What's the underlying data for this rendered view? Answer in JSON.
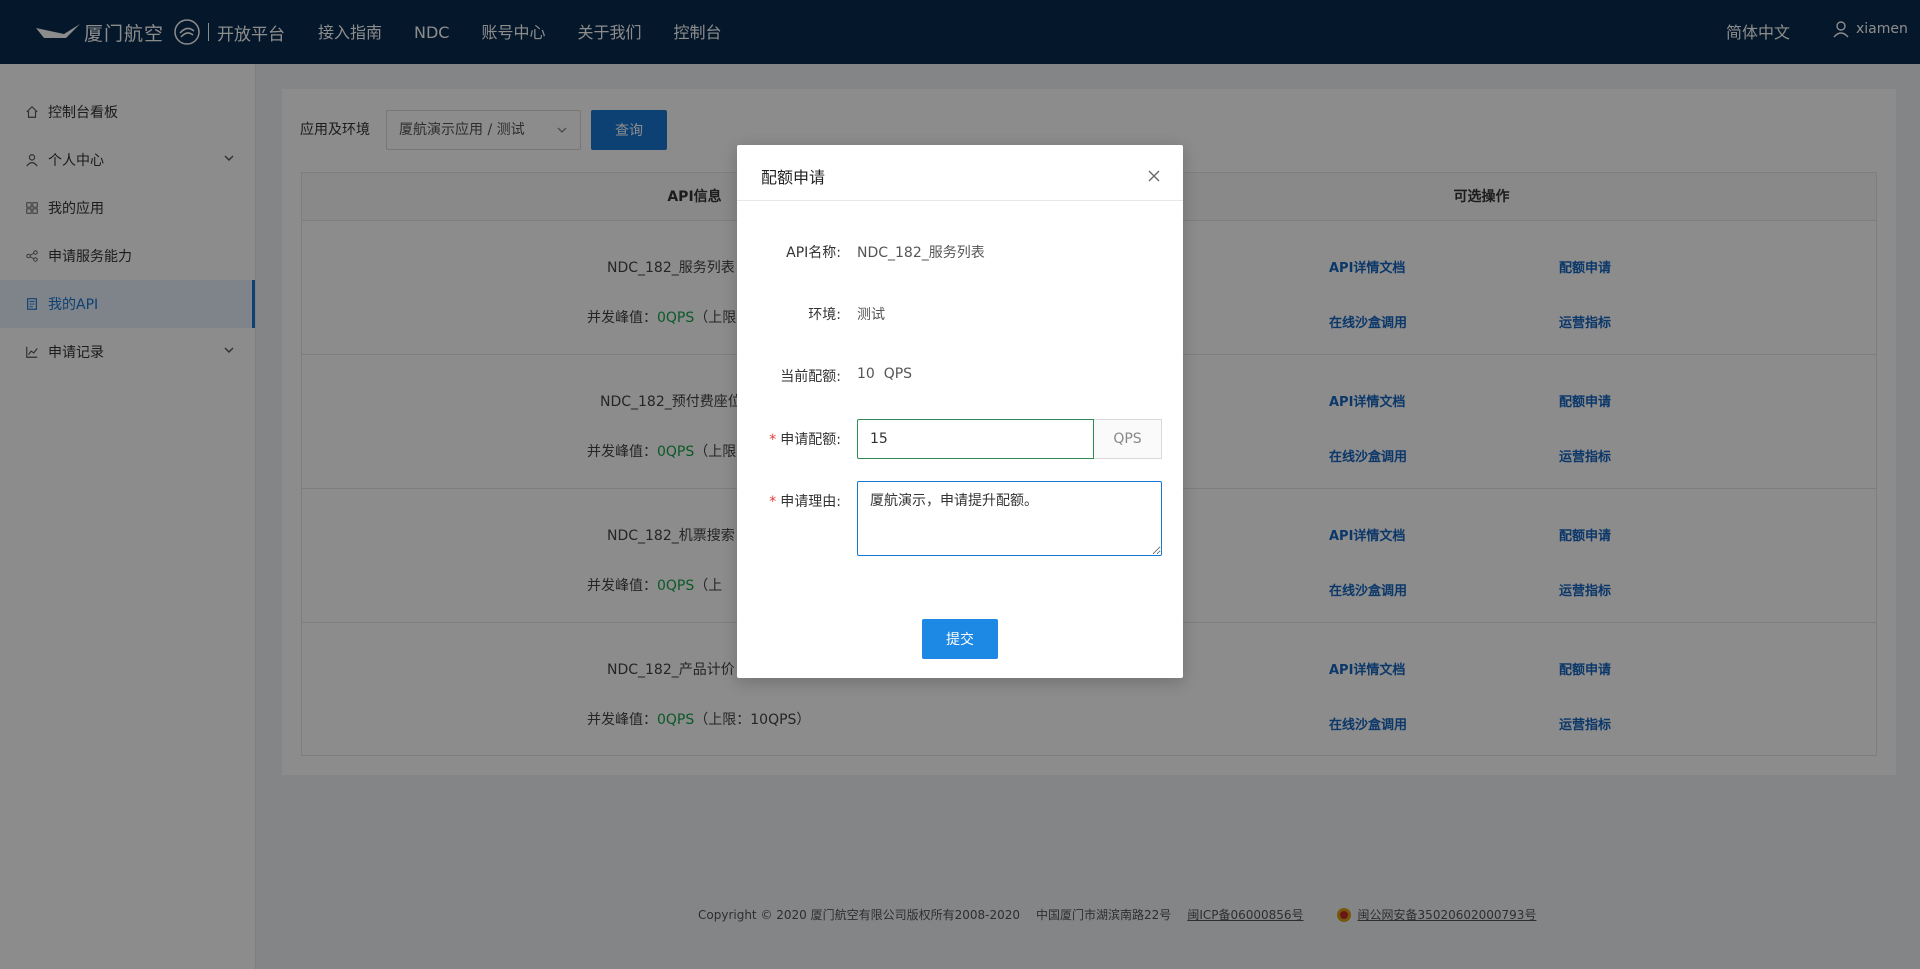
{
  "header": {
    "logo_text": "厦门航空",
    "logo_sub": "开放平台",
    "nav": [
      "接入指南",
      "NDC",
      "账号中心",
      "关于我们",
      "控制台"
    ],
    "language": "简体中文",
    "username": "xiamen"
  },
  "sidebar": {
    "items": [
      {
        "label": "控制台看板",
        "icon": "home-icon"
      },
      {
        "label": "个人中心",
        "icon": "user-icon",
        "expandable": true
      },
      {
        "label": "我的应用",
        "icon": "grid-icon"
      },
      {
        "label": "申请服务能力",
        "icon": "share-icon"
      },
      {
        "label": "我的API",
        "icon": "document-icon",
        "active": true
      },
      {
        "label": "申请记录",
        "icon": "chart-icon",
        "expandable": true
      }
    ]
  },
  "filter": {
    "label": "应用及环境",
    "selected": "厦航演示应用 / 测试",
    "query_button": "查询"
  },
  "table": {
    "headers": {
      "api": "API信息",
      "ops": "可选操作"
    },
    "rows": [
      {
        "name": "NDC_182_服务列表（",
        "qps_prefix": "并发峰值：",
        "qps_value": "0QPS",
        "qps_suffix": "（上限："
      },
      {
        "name": "NDC_182_预付费座位",
        "qps_prefix": "并发峰值：",
        "qps_value": "0QPS",
        "qps_suffix": "（上限："
      },
      {
        "name": "NDC_182_机票搜索（",
        "qps_prefix": "并发峰值：",
        "qps_value": "0QPS",
        "qps_suffix": "（上"
      },
      {
        "name": "NDC_182_产品计价（",
        "qps_prefix": "并发峰值：",
        "qps_value": "0QPS",
        "qps_suffix": "（上限：10QPS）"
      }
    ],
    "ops": {
      "doc": "API详情文档",
      "quota": "配额申请",
      "sandbox": "在线沙盒调用",
      "metrics": "运营指标"
    }
  },
  "footer": {
    "copyright": "Copyright © 2020 厦门航空有限公司版权所有2008-2020",
    "address": "中国厦门市湖滨南路22号",
    "icp": "闽ICP备06000856号",
    "police": "闽公网安备35020602000793号"
  },
  "modal": {
    "title": "配额申请",
    "fields": {
      "api_name_label": "API名称:",
      "api_name_value": "NDC_182_服务列表",
      "env_label": "环境:",
      "env_value": "测试",
      "current_label": "当前配额:",
      "current_value": "10  QPS",
      "request_label": "申请配额:",
      "request_value": "15",
      "request_unit": "QPS",
      "reason_label": "申请理由:",
      "reason_value": "厦航演示，申请提升配额。",
      "required_mark": "*"
    },
    "submit": "提交"
  },
  "colors": {
    "header_bg": "#0a2a4d",
    "primary": "#1976d2",
    "success": "#16a34a",
    "required": "#e53935"
  }
}
